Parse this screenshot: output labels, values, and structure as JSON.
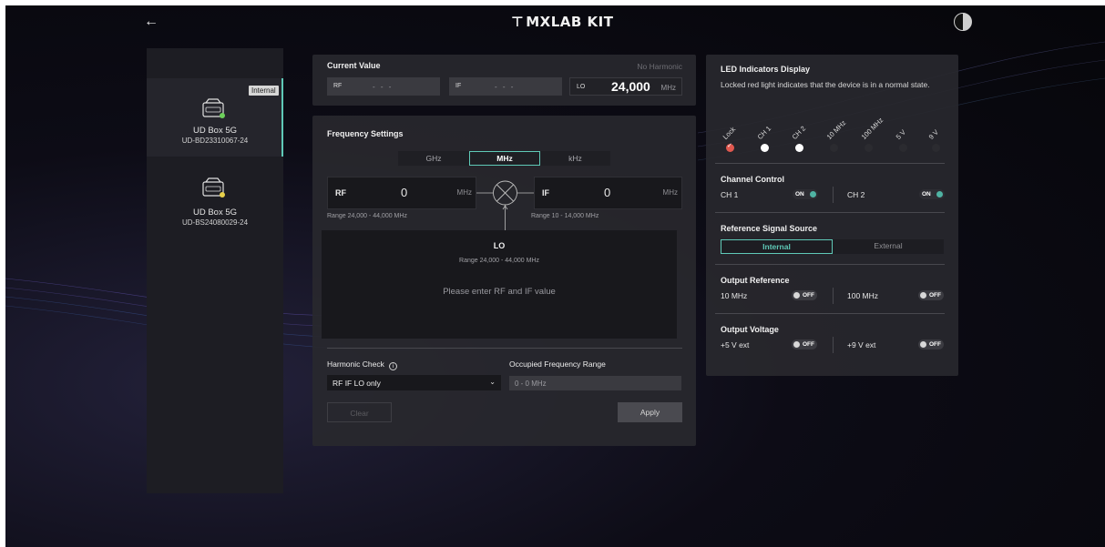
{
  "app": {
    "title": "MXLAB KIT",
    "theme_toggle": "theme-toggle"
  },
  "sidebar": {
    "devices": [
      {
        "name": "UD Box 5G",
        "serial": "UD-BD23310067-24",
        "tag": "Internal",
        "status_color": "#6ccf5a",
        "active": true
      },
      {
        "name": "UD Box 5G",
        "serial": "UD-BS24080029-24",
        "tag": "",
        "status_color": "#e7d04a",
        "active": false
      }
    ]
  },
  "current_value": {
    "title": "Current Value",
    "harmonic_status": "No Harmonic",
    "rf": {
      "label": "RF",
      "value": "- - -"
    },
    "if": {
      "label": "IF",
      "value": "- - -"
    },
    "lo": {
      "label": "LO",
      "value": "24,000",
      "unit": "MHz"
    }
  },
  "frequency_settings": {
    "title": "Frequency Settings",
    "units": [
      "GHz",
      "MHz",
      "kHz"
    ],
    "selected_unit": "MHz",
    "rf": {
      "label": "RF",
      "value": "0",
      "unit": "MHz",
      "range": "Range 24,000 - 44,000 MHz"
    },
    "if": {
      "label": "IF",
      "value": "0",
      "unit": "MHz",
      "range": "Range 10 - 14,000 MHz"
    },
    "lo": {
      "label": "LO",
      "range": "Range 24,000 - 44,000 MHz",
      "message": "Please enter RF and IF value"
    },
    "harmonic_check": {
      "label": "Harmonic Check",
      "selected": "RF IF LO only"
    },
    "occupied_range": {
      "label": "Occupied Frequency Range",
      "value": "0 - 0 MHz"
    },
    "clear_label": "Clear",
    "apply_label": "Apply"
  },
  "right_panel": {
    "led": {
      "title": "LED Indicators Display",
      "description": "Locked red light indicates that the device is in a normal state.",
      "indicators": [
        {
          "label": "Lock",
          "color": "#e0584f"
        },
        {
          "label": "CH 1",
          "color": "#ffffff"
        },
        {
          "label": "CH 2",
          "color": "#ffffff"
        },
        {
          "label": "10 MHz",
          "color": "#2b2b30"
        },
        {
          "label": "100 MHz",
          "color": "#2b2b30"
        },
        {
          "label": "5 V",
          "color": "#2b2b30"
        },
        {
          "label": "9 V",
          "color": "#2b2b30"
        }
      ]
    },
    "channel_control": {
      "title": "Channel Control",
      "ch1": {
        "label": "CH 1",
        "state": "ON"
      },
      "ch2": {
        "label": "CH 2",
        "state": "ON"
      }
    },
    "reference_source": {
      "title": "Reference Signal Source",
      "options": [
        "Internal",
        "External"
      ],
      "selected": "Internal"
    },
    "output_reference": {
      "title": "Output Reference",
      "a": {
        "label": "10 MHz",
        "state": "OFF"
      },
      "b": {
        "label": "100 MHz",
        "state": "OFF"
      }
    },
    "output_voltage": {
      "title": "Output Voltage",
      "a": {
        "label": "+5 V ext",
        "state": "OFF"
      },
      "b": {
        "label": "+9 V ext",
        "state": "OFF"
      }
    }
  },
  "colors": {
    "accent": "#5fc9b7",
    "panel": "#28282e",
    "background": "#0d0c16"
  }
}
